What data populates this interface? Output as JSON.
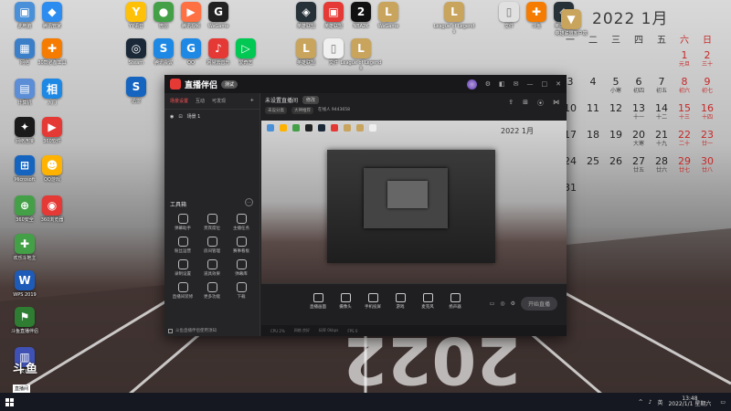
{
  "desktop_icons": [
    {
      "label": "此电脑",
      "color": "#4a90d9",
      "glyph": "▣"
    },
    {
      "label": "腾讯管家",
      "color": "#2d8cf0",
      "glyph": "◆"
    },
    {
      "label": "网络",
      "color": "#3c7fc9",
      "glyph": "▦"
    },
    {
      "label": "30款必备工具",
      "color": "#f57c00",
      "glyph": "✚"
    },
    {
      "label": "计算机",
      "color": "#5b8ed6",
      "glyph": "▤"
    },
    {
      "label": "入门",
      "color": "#1e88e5",
      "glyph": "相"
    },
    {
      "label": "网络连接",
      "color": "#1a1a1a",
      "glyph": "✦"
    },
    {
      "label": "360软件",
      "color": "#e53935",
      "glyph": "▶"
    },
    {
      "label": "Microsoft",
      "color": "#1565c0",
      "glyph": "⊞"
    },
    {
      "label": "QQ游戏",
      "color": "#ffb300",
      "glyph": "☻"
    },
    {
      "label": "360安全",
      "color": "#43a047",
      "glyph": "⊕"
    },
    {
      "label": "360浏览器",
      "color": "#e53935",
      "glyph": "◉"
    },
    {
      "label": "欢乐斗地主",
      "color": "#43a047",
      "glyph": "✚"
    },
    {
      "label": "WPS 2019",
      "color": "#1e5bb8",
      "glyph": "W"
    },
    {
      "label": "斗鱼直播伴侣",
      "color": "#2e7d32",
      "glyph": "⚑"
    },
    {
      "label": "文档",
      "color": "#3f51b5",
      "glyph": "▥"
    },
    {
      "label": "YY语音",
      "color": "#ffc107",
      "glyph": "Y"
    },
    {
      "label": "微信",
      "color": "#43a047",
      "glyph": "●"
    },
    {
      "label": "腾讯视频",
      "color": "#ff7043",
      "glyph": "▶"
    },
    {
      "label": "WeGame",
      "color": "#212121",
      "glyph": "G"
    },
    {
      "label": "Steam",
      "color": "#1b2838",
      "glyph": "◎"
    },
    {
      "label": "腾讯会议",
      "color": "#1e88e5",
      "glyph": "S"
    },
    {
      "label": "QQ",
      "color": "#1e88e5",
      "glyph": "G"
    },
    {
      "label": "网易云音乐",
      "color": "#e53935",
      "glyph": "♪"
    },
    {
      "label": "爱奇艺",
      "color": "#00c853",
      "glyph": "▷"
    },
    {
      "label": "迅雷",
      "color": "#1565c0",
      "glyph": "S"
    },
    {
      "label": "英雄联盟",
      "color": "#263238",
      "glyph": "◈"
    },
    {
      "label": "英雄联盟",
      "color": "#e53935",
      "glyph": "▣"
    },
    {
      "label": "NBA2K",
      "color": "#111111",
      "glyph": "2"
    },
    {
      "label": "WeGame",
      "color": "#c8a45d",
      "glyph": "L"
    },
    {
      "label": "英雄联盟",
      "color": "#c8a45d",
      "glyph": "L"
    },
    {
      "label": "文件",
      "color": "#f0f0f0",
      "glyph": "▯"
    },
    {
      "label": "League of Legends",
      "color": "#c8a45d",
      "glyph": "L"
    },
    {
      "label": "League of Legends",
      "color": "#c8a45d",
      "glyph": "L"
    },
    {
      "label": "文件",
      "color": "#e0e0e0",
      "glyph": "▯"
    },
    {
      "label": "斗鱼",
      "color": "#f57c00",
      "glyph": "✚"
    },
    {
      "label": "英雄联盟",
      "color": "#263238",
      "glyph": "◈"
    },
    {
      "label": "英雄联盟客户端",
      "color": "#c8a45d",
      "glyph": "▼"
    }
  ],
  "calendar": {
    "title": "2022 1月",
    "weekdays": [
      "一",
      "二",
      "三",
      "四",
      "五",
      "六",
      "日"
    ],
    "weeks": [
      [
        {
          "d": "",
          "l": ""
        },
        {
          "d": "",
          "l": ""
        },
        {
          "d": "",
          "l": ""
        },
        {
          "d": "",
          "l": ""
        },
        {
          "d": "",
          "l": ""
        },
        {
          "d": "1",
          "l": "元旦"
        },
        {
          "d": "2",
          "l": "三十"
        }
      ],
      [
        {
          "d": "3",
          "l": ""
        },
        {
          "d": "4",
          "l": ""
        },
        {
          "d": "5",
          "l": "小寒"
        },
        {
          "d": "6",
          "l": "初四"
        },
        {
          "d": "7",
          "l": "初五"
        },
        {
          "d": "8",
          "l": "初六"
        },
        {
          "d": "9",
          "l": "初七"
        }
      ],
      [
        {
          "d": "10",
          "l": ""
        },
        {
          "d": "11",
          "l": ""
        },
        {
          "d": "12",
          "l": ""
        },
        {
          "d": "13",
          "l": "十一"
        },
        {
          "d": "14",
          "l": "十二"
        },
        {
          "d": "15",
          "l": "十三"
        },
        {
          "d": "16",
          "l": "十四"
        }
      ],
      [
        {
          "d": "17",
          "l": ""
        },
        {
          "d": "18",
          "l": ""
        },
        {
          "d": "19",
          "l": ""
        },
        {
          "d": "20",
          "l": "大寒"
        },
        {
          "d": "21",
          "l": "十九"
        },
        {
          "d": "22",
          "l": "二十"
        },
        {
          "d": "23",
          "l": "廿一"
        }
      ],
      [
        {
          "d": "24",
          "l": ""
        },
        {
          "d": "25",
          "l": ""
        },
        {
          "d": "26",
          "l": ""
        },
        {
          "d": "27",
          "l": "廿五"
        },
        {
          "d": "28",
          "l": "廿六"
        },
        {
          "d": "29",
          "l": "廿七"
        },
        {
          "d": "30",
          "l": "廿八"
        }
      ],
      [
        {
          "d": "31",
          "l": ""
        },
        {
          "d": "",
          "l": ""
        },
        {
          "d": "",
          "l": ""
        },
        {
          "d": "",
          "l": ""
        },
        {
          "d": "",
          "l": ""
        },
        {
          "d": "",
          "l": ""
        },
        {
          "d": "",
          "l": ""
        }
      ]
    ]
  },
  "app": {
    "name": "直播伴侣",
    "version": "测试",
    "tabs": [
      "场景设置",
      "互动",
      "可发现"
    ],
    "scene_label": "场景 1",
    "room_title": "未设置直播间",
    "room_badge": "修改",
    "room_meta": [
      "未设分类",
      "大神推荐",
      "在线人 9443658"
    ],
    "tools_title": "工具箱",
    "tools": [
      "弹幕助手",
      "贵宾席位",
      "主播任务",
      "粉丝运营",
      "房间管理",
      "赛事看板",
      "录制设置",
      "道具效果",
      "弹幕库",
      "直播间装修",
      "更多功能",
      "下载"
    ],
    "footer_note": "斗鱼直播伴侣使用须知",
    "controls": [
      "直播画面",
      "摄像头",
      "手机投屏",
      "游戏",
      "麦克风",
      "扬声器"
    ],
    "go_live": "开始直播",
    "status": [
      "CPU 2%",
      "网络 良好",
      "码率 0kbps",
      "FPS 0"
    ],
    "preview_calendar": "2022 1月",
    "preview_watermark": "2022"
  },
  "streamer": {
    "brand": "斗鱼",
    "tag": "直播间",
    "room_id": "9443658"
  },
  "taskbar": {
    "time": "13:48",
    "date": "2022/1/1 星期六",
    "tray": [
      "^",
      "♪",
      "英"
    ]
  }
}
